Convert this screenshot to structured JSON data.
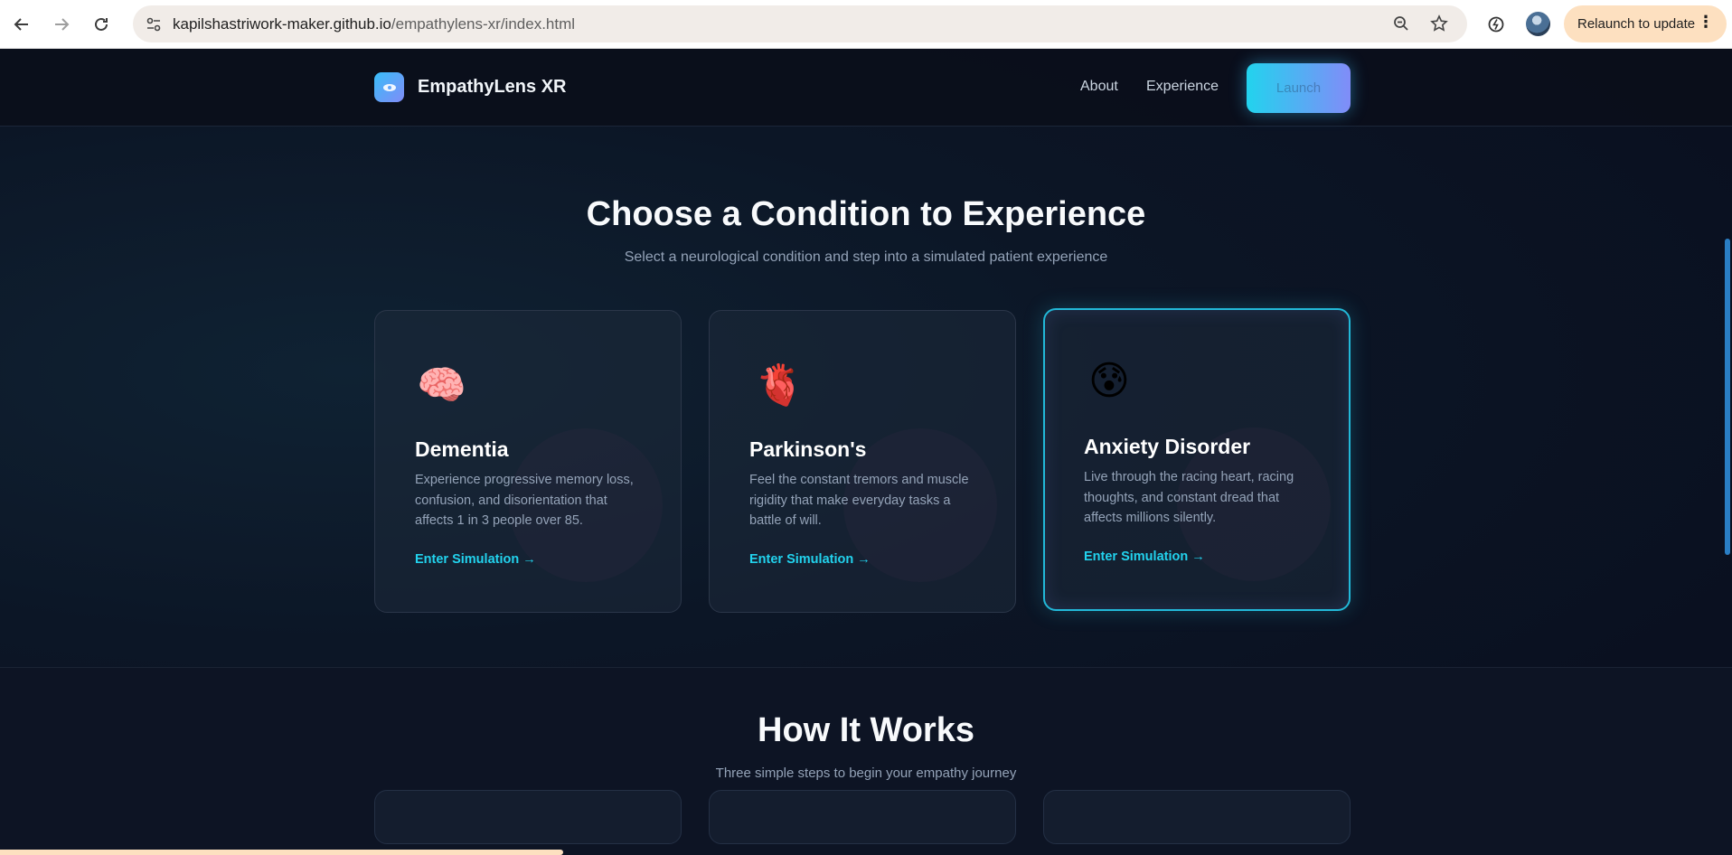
{
  "browser": {
    "url_host": "kapilshastriwork-maker.github.io",
    "url_path": "/empathylens-xr/index.html",
    "relaunch_label": "Relaunch to update"
  },
  "site": {
    "brand": "EmpathyLens XR",
    "nav": [
      "About",
      "Experience"
    ],
    "cta_label": "Launch"
  },
  "conditions": {
    "title": "Choose a Condition to Experience",
    "subtitle": "Select a neurological condition and step into a simulated patient experience",
    "cards": [
      {
        "emoji": "🧠",
        "title": "Dementia",
        "description": "Experience progressive memory loss, confusion, and disorientation that affects 1 in 3 people over 85.",
        "link": "Enter Simulation →"
      },
      {
        "emoji": "🫀",
        "title": "Parkinson's",
        "description": "Feel the constant tremors and muscle rigidity that make everyday tasks a battle of will.",
        "link": "Enter Simulation →"
      },
      {
        "emoji": "😰",
        "title": "Anxiety Disorder",
        "description": "Live through the racing heart, racing thoughts, and constant dread that affects millions silently.",
        "link": "Enter Simulation →"
      }
    ]
  },
  "how_it_works": {
    "title": "How It Works",
    "subtitle": "Three simple steps to begin your empathy journey"
  }
}
